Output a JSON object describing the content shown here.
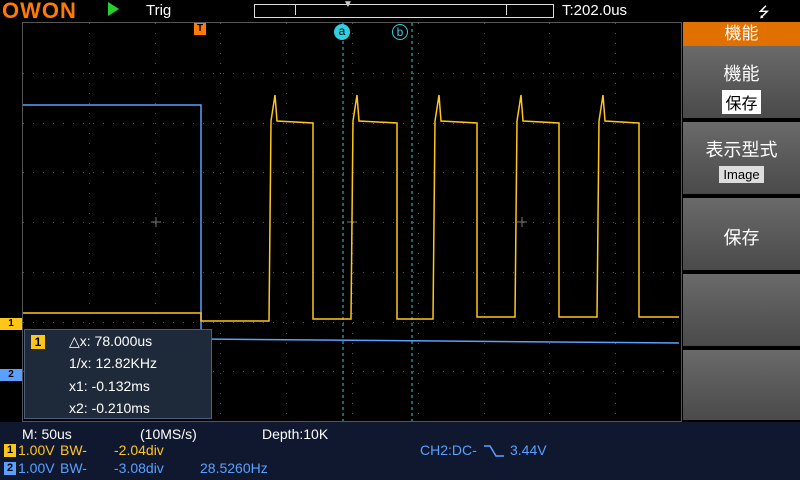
{
  "topbar": {
    "brand": "OWON",
    "run_state_icon": "play-icon",
    "trigger_status": "Trig",
    "trigger_time": "T:202.0us",
    "usb_icon": "usb-icon",
    "buffer_marker_icon": "down-triangle-marker"
  },
  "markers": {
    "trigger": "T",
    "cursor_a": "a",
    "cursor_b": "b",
    "ch1": "1",
    "ch2": "2"
  },
  "menu": {
    "header": "機能",
    "items": [
      {
        "title": "機能",
        "value": "保存"
      },
      {
        "title": "表示型式",
        "value": "Image"
      },
      {
        "title": "保存",
        "value": ""
      }
    ]
  },
  "cursor_info": {
    "channel": "1",
    "delta_x": "△x: 78.000us",
    "inv_delta_x": "1/x:  12.82KHz",
    "x1": "x1: -0.132ms",
    "x2": "x2: -0.210ms"
  },
  "status": {
    "timebase": "M: 50us",
    "sample_rate": "(10MS/s)",
    "depth": "Depth:10K",
    "ch1": {
      "badge": "1",
      "scale": "1.00V",
      "bw": "BW-",
      "position": "-2.04div"
    },
    "ch2": {
      "badge": "2",
      "scale": "1.00V",
      "bw": "BW-",
      "position": "-3.08div",
      "frequency": "28.5260Hz"
    },
    "trigger_info": "CH2:DC-",
    "trigger_level": "3.44V"
  },
  "colors": {
    "ch1": "#ffc61a",
    "ch2": "#5aa0ff",
    "brand": "#ff7a00",
    "menu_header": "#e07000",
    "cursor_line": "#30d0e0"
  }
}
